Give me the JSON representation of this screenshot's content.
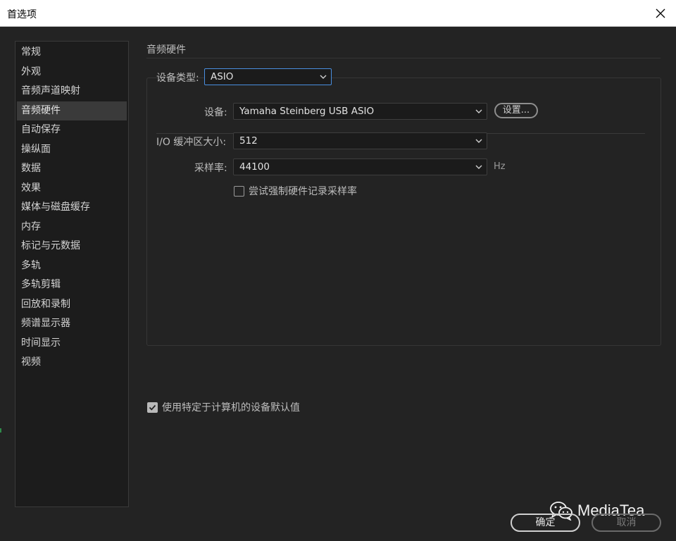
{
  "window": {
    "title": "首选项"
  },
  "sidebar": {
    "items": [
      {
        "label": "常规"
      },
      {
        "label": "外观"
      },
      {
        "label": "音频声道映射"
      },
      {
        "label": "音频硬件",
        "active": true
      },
      {
        "label": "自动保存"
      },
      {
        "label": "操纵面"
      },
      {
        "label": "数据"
      },
      {
        "label": "效果"
      },
      {
        "label": "媒体与磁盘缓存"
      },
      {
        "label": "内存"
      },
      {
        "label": "标记与元数据"
      },
      {
        "label": "多轨"
      },
      {
        "label": "多轨剪辑"
      },
      {
        "label": "回放和录制"
      },
      {
        "label": "频谱显示器"
      },
      {
        "label": "时间显示"
      },
      {
        "label": "视频"
      }
    ]
  },
  "main": {
    "section_title": "音频硬件",
    "device_type": {
      "label": "设备类型:",
      "value": "ASIO"
    },
    "device": {
      "label": "设备:",
      "value": "Yamaha Steinberg USB ASIO",
      "settings_button": "设置..."
    },
    "buffer_size": {
      "label": "I/O 缓冲区大小:",
      "value": "512"
    },
    "sample_rate": {
      "label": "采样率:",
      "value": "44100",
      "unit": "Hz"
    },
    "force_sample_rate": {
      "label": "尝试强制硬件记录采样率",
      "checked": false
    },
    "use_machine_defaults": {
      "label": "使用特定于计算机的设备默认值",
      "checked": true
    }
  },
  "footer": {
    "ok_label": "确定",
    "cancel_label": "取消"
  },
  "watermark": {
    "text": "MediaTea"
  },
  "colors": {
    "accent_focus": "#4a8fe0",
    "background": "#232323",
    "sidebar_active": "#3a3a3a"
  }
}
